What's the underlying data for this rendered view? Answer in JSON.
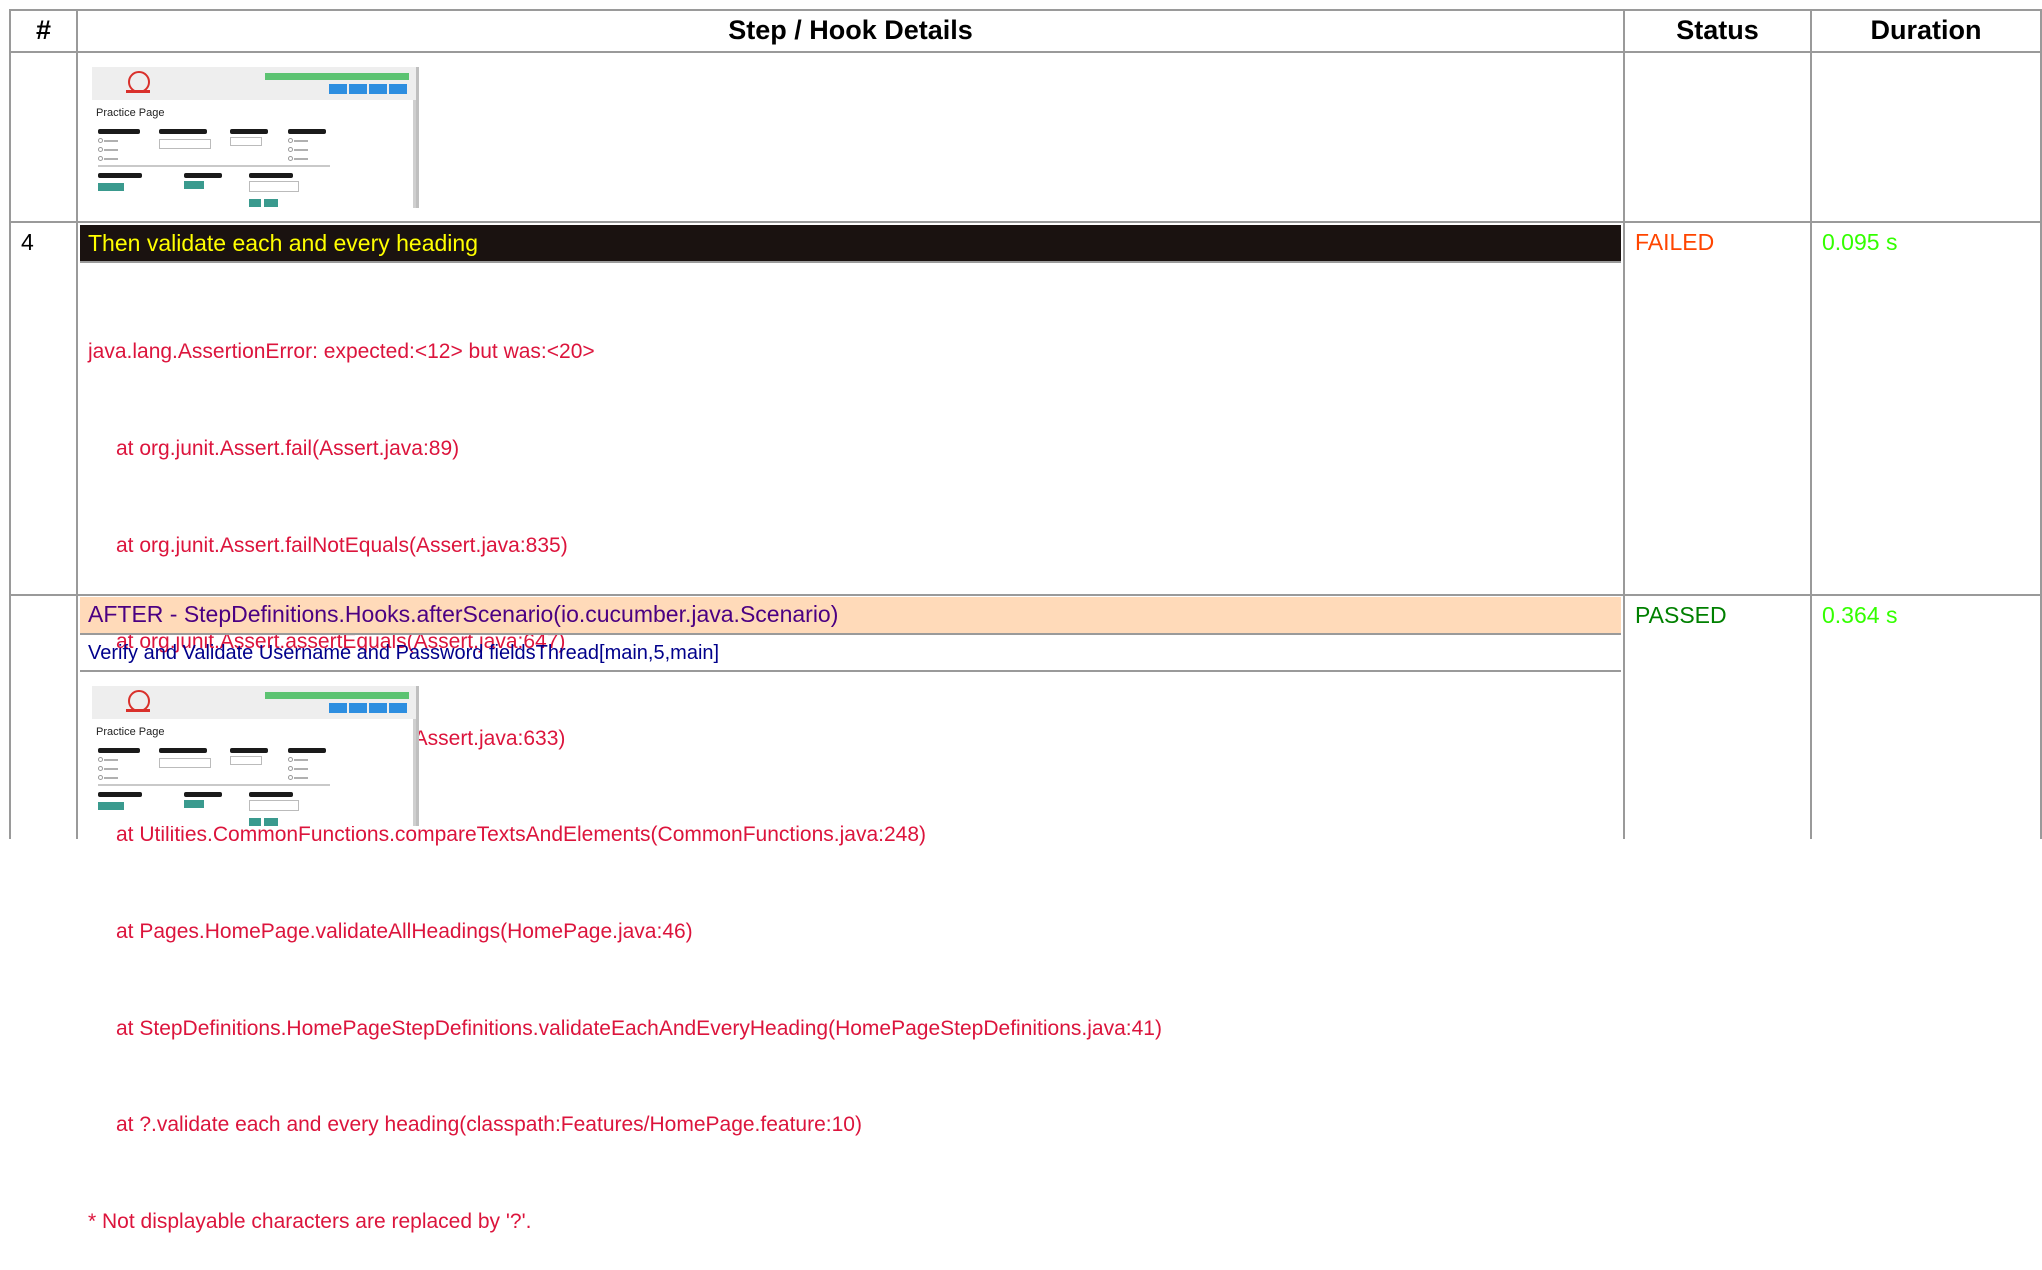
{
  "table": {
    "headers": {
      "num": "#",
      "details": "Step / Hook Details",
      "status": "Status",
      "duration": "Duration"
    }
  },
  "rows": [
    {
      "num": "4",
      "step": "Then validate each and every heading",
      "status": "FAILED",
      "duration": "0.095 s",
      "error_lines": [
        "java.lang.AssertionError: expected:<12> but was:<20>",
        "at org.junit.Assert.fail(Assert.java:89)",
        "at org.junit.Assert.failNotEquals(Assert.java:835)",
        "at org.junit.Assert.assertEquals(Assert.java:647)",
        "at org.junit.Assert.assertEquals(Assert.java:633)",
        "at Utilities.CommonFunctions.compareTextsAndElements(CommonFunctions.java:248)",
        "at Pages.HomePage.validateAllHeadings(HomePage.java:46)",
        "at StepDefinitions.HomePageStepDefinitions.validateEachAndEveryHeading(HomePageStepDefinitions.java:41)",
        "at ?.validate each and every heading(classpath:Features/HomePage.feature:10)",
        "* Not displayable characters are replaced by '?'."
      ]
    },
    {
      "hook": "AFTER - StepDefinitions.Hooks.afterScenario(io.cucumber.java.Scenario)",
      "status": "PASSED",
      "duration": "0.364 s",
      "log": "Verify and Validate Username and Password fieldsThread[main,5,main]"
    }
  ],
  "screenshot": {
    "page_title": "Practice Page"
  },
  "colors": {
    "step_bg": "#1a1210",
    "step_text": "#ffff00",
    "failed": "#ff4500",
    "passed": "#008000",
    "duration": "#33ff00",
    "error_text": "#dc143c",
    "hook_bg": "#ffdab9",
    "hook_text": "#4b0082",
    "log_text": "#00008b",
    "grid": "#9a9a9a"
  }
}
